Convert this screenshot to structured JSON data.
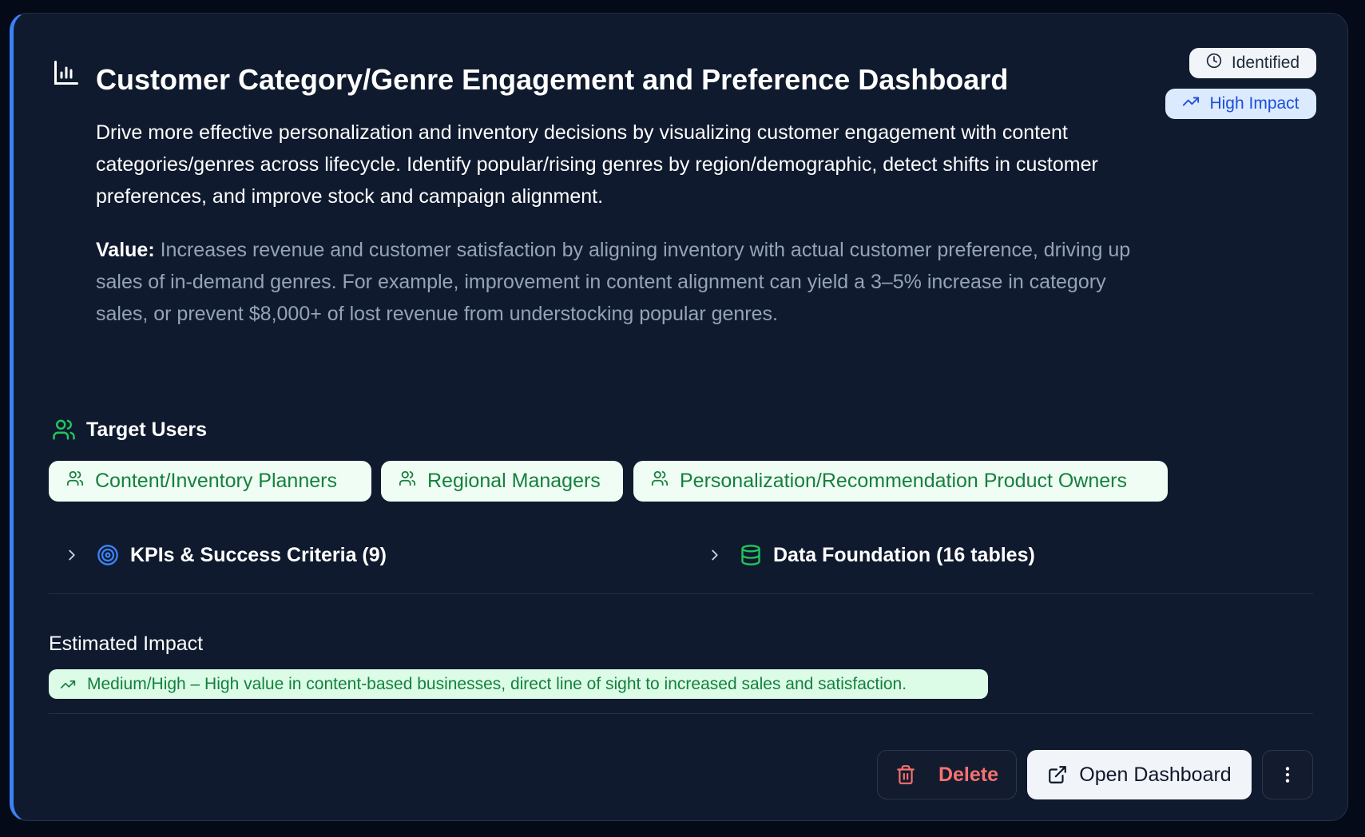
{
  "card": {
    "title": "Customer Category/Genre Engagement and Preference Dashboard",
    "title_icon": "bar-chart-icon",
    "status_badge": {
      "label": "Identified",
      "icon": "clock-icon"
    },
    "impact_badge": {
      "label": "High Impact",
      "icon": "trending-up-icon"
    },
    "description": "Drive more effective personalization and inventory decisions by visualizing customer engagement with content categories/genres across lifecycle. Identify popular/rising genres by region/demographic, detect shifts in customer preferences, and improve stock and campaign alignment.",
    "value_label": "Value:",
    "value_text": "Increases revenue and customer satisfaction by aligning inventory with actual customer preference, driving up sales of in-demand genres. For example, improvement in content alignment can yield a 3–5% increase in category sales, or prevent $8,000+ of lost revenue from understocking popular genres."
  },
  "target_users": {
    "title": "Target Users",
    "icon": "users-icon",
    "chips": [
      {
        "label": "Content/Inventory Planners"
      },
      {
        "label": "Regional Managers"
      },
      {
        "label": "Personalization/Recommendation Product Owners"
      }
    ]
  },
  "sections": {
    "kpis": {
      "label": "KPIs & Success Criteria (9)",
      "icon": "target-icon"
    },
    "data_foundation": {
      "label": "Data Foundation (16 tables)",
      "icon": "database-icon"
    }
  },
  "estimated_impact": {
    "title": "Estimated Impact",
    "text": "Medium/High – High value in content-based businesses, direct line of sight to increased sales and satisfaction."
  },
  "actions": {
    "delete_label": "Delete",
    "open_label": "Open Dashboard"
  },
  "colors": {
    "background": "#050a18",
    "card": "#101a2e",
    "accent": "#3b82f6",
    "green": "#15803d",
    "delete_red": "#f87171"
  }
}
